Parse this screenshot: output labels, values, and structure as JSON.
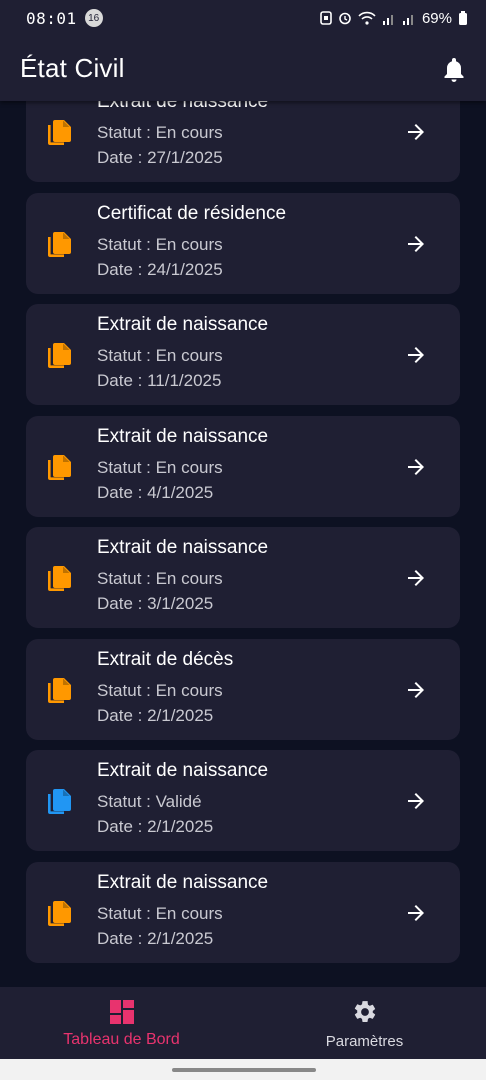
{
  "status_bar": {
    "time": "08:01",
    "notification_count": "16",
    "battery": "69%"
  },
  "app_bar": {
    "title": "État Civil",
    "bell_icon": "bell-icon"
  },
  "colors": {
    "pending_icon": "#ff9800",
    "validated_icon": "#2196f3",
    "accent": "#e8336e"
  },
  "requests": [
    {
      "title": "Extrait de naissance",
      "status": "Statut : En cours",
      "date": "Date : 27/1/2025",
      "icon": "document-copy-icon",
      "state": "pending"
    },
    {
      "title": "Certificat de résidence",
      "status": "Statut : En cours",
      "date": "Date : 24/1/2025",
      "icon": "document-copy-icon",
      "state": "pending"
    },
    {
      "title": "Extrait de naissance",
      "status": "Statut : En cours",
      "date": "Date : 11/1/2025",
      "icon": "document-copy-icon",
      "state": "pending"
    },
    {
      "title": "Extrait de naissance",
      "status": "Statut : En cours",
      "date": "Date : 4/1/2025",
      "icon": "document-copy-icon",
      "state": "pending"
    },
    {
      "title": "Extrait de naissance",
      "status": "Statut : En cours",
      "date": "Date : 3/1/2025",
      "icon": "document-copy-icon",
      "state": "pending"
    },
    {
      "title": "Extrait de décès",
      "status": "Statut : En cours",
      "date": "Date : 2/1/2025",
      "icon": "document-copy-icon",
      "state": "pending"
    },
    {
      "title": "Extrait de naissance",
      "status": "Statut : Validé",
      "date": "Date : 2/1/2025",
      "icon": "document-copy-icon",
      "state": "validated"
    },
    {
      "title": "Extrait de naissance",
      "status": "Statut : En cours",
      "date": "Date : 2/1/2025",
      "icon": "document-copy-icon",
      "state": "pending"
    }
  ],
  "bottom_nav": {
    "items": [
      {
        "label": "Tableau de Bord",
        "icon": "dashboard-icon",
        "active": true
      },
      {
        "label": "Paramètres",
        "icon": "gear-icon",
        "active": false
      }
    ]
  }
}
